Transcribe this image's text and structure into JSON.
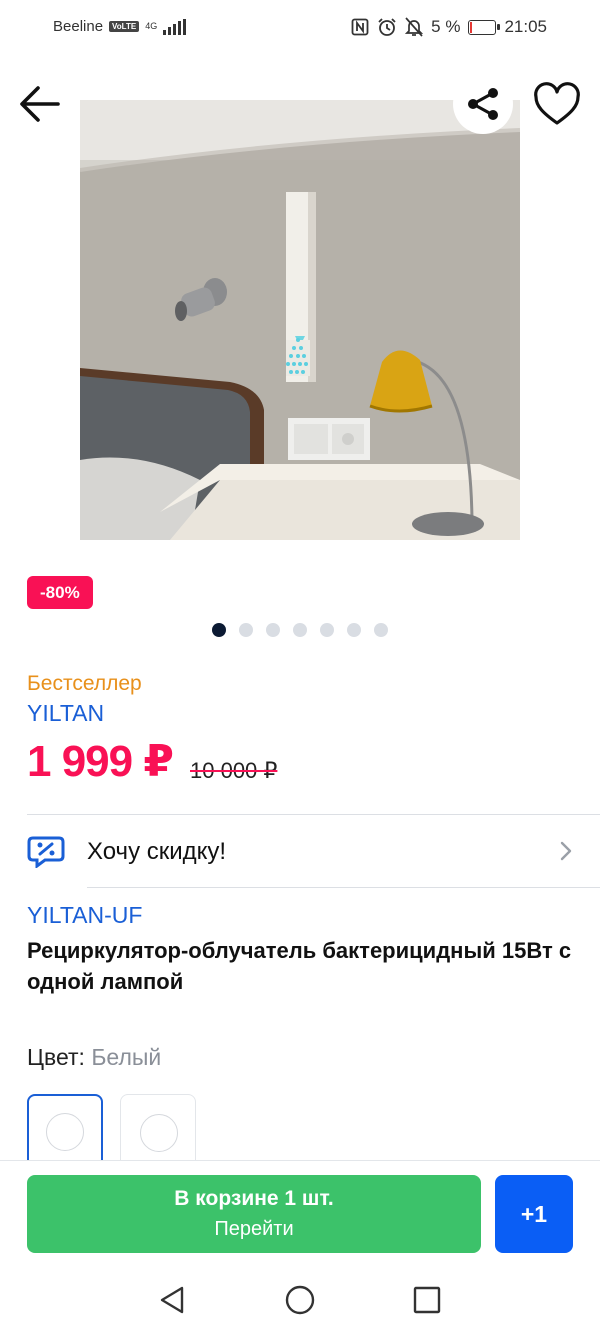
{
  "status_bar": {
    "carrier": "Beeline",
    "volte": "VoLTE",
    "network": "4G",
    "battery": "5 %",
    "battery_level": 0.05,
    "time": "21:05"
  },
  "product": {
    "discount_badge": "-80%",
    "gallery": {
      "count": 7,
      "active_index": 0
    },
    "bestseller_label": "Бестселлер",
    "brand": "YILTAN",
    "price": "1 999 ₽",
    "old_price": "10 000 ₽",
    "discount_request": "Хочу скидку!",
    "model": "YILTAN-UF",
    "title": "Рециркулятор-облучатель бактерицидный 15Вт с одной лампой",
    "color_label": "Цвет:",
    "color_value": "Белый"
  },
  "bottom_bar": {
    "cart_line1": "В корзине 1 шт.",
    "cart_line2": "Перейти",
    "plus_label": "+1"
  },
  "colors": {
    "accent_pink": "#f91155",
    "brand_blue": "#1a5fd6",
    "bestseller_orange": "#e8901b",
    "cart_green": "#3cc26a",
    "button_blue": "#0a5ef5"
  },
  "icons": {
    "back": "arrow-left-icon",
    "share": "share-icon",
    "favorite": "heart-icon",
    "discount": "percent-badge-icon",
    "chevron": "chevron-right-icon"
  }
}
